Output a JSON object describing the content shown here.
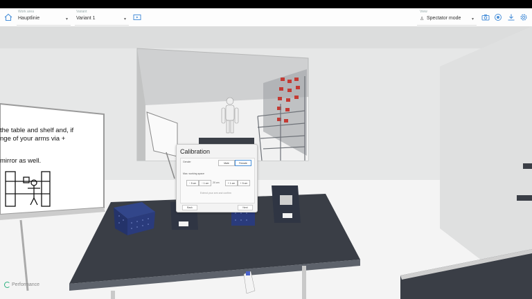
{
  "toolbar": {
    "workcell": {
      "label": "Work area",
      "value": "Hauptlinie"
    },
    "variant": {
      "label": "Variant",
      "value": "Variant 1"
    },
    "view": {
      "label": "View",
      "value": "Spectator mode"
    }
  },
  "whiteboard": {
    "line1": "the table and shelf and, if",
    "line2": "nge of your arms via +",
    "line3": "mirror as well."
  },
  "calibration": {
    "title": "Calibration",
    "gender_label": "Gender",
    "option_a": "Male",
    "option_b": "Female",
    "workspace_label": "Max. working space",
    "btn1": "− 5 cm",
    "btn2": "− 1 cm",
    "value": "20 cm",
    "btn3": "+ 1 cm",
    "btn4": "+ 5 cm",
    "hint": "Extend your arm and confirm",
    "back": "Back",
    "next": "Next"
  },
  "status": {
    "brand": "Performance"
  },
  "colors": {
    "accent": "#4a90d9",
    "brand": "#2bb07f"
  }
}
